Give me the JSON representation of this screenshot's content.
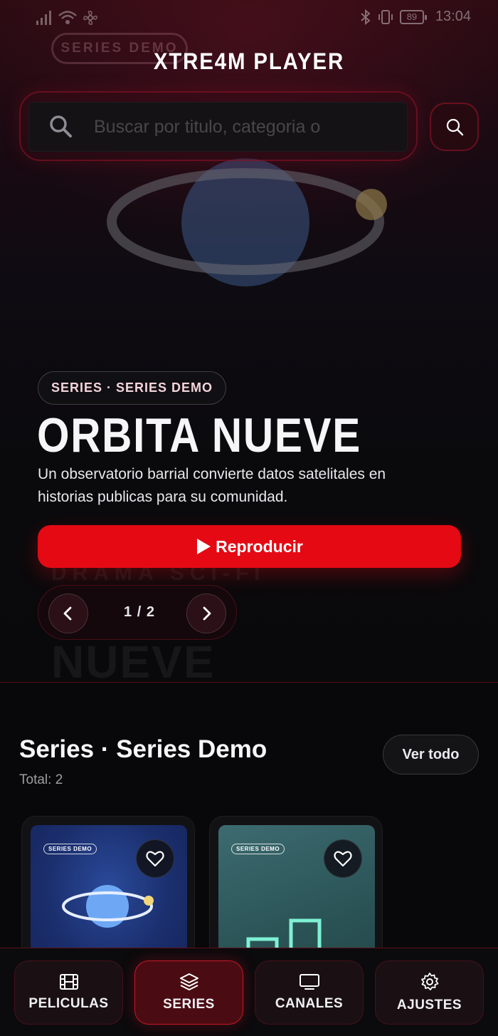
{
  "status_bar": {
    "time": "13:04",
    "battery": "89"
  },
  "app": {
    "title": "XTRE4M PLAYER"
  },
  "search": {
    "placeholder": "Buscar por titulo, categoria o"
  },
  "hero": {
    "background_badge": "SERIES DEMO",
    "background_genre": "DRAMA SCI-FI",
    "background_title": "NUEVE",
    "category_badge": "SERIES · SERIES DEMO",
    "title": "ORBITA NUEVE",
    "description": "Un observatorio barrial convierte datos satelitales en historias publicas para su comunidad.",
    "play_label": "Reproducir",
    "page_indicator": "1 / 2"
  },
  "section": {
    "title": "Series · Series Demo",
    "total": "Total: 2",
    "see_all_label": "Ver todo"
  },
  "cards": [
    {
      "tag": "SERIES DEMO",
      "icon": "heart-icon"
    },
    {
      "tag": "SERIES DEMO",
      "icon": "heart-icon"
    }
  ],
  "bottom_nav": [
    {
      "label": "PELICULAS",
      "icon": "film-icon",
      "active": false
    },
    {
      "label": "SERIES",
      "icon": "layers-icon",
      "active": true
    },
    {
      "label": "CANALES",
      "icon": "tv-icon",
      "active": false
    },
    {
      "label": "AJUSTES",
      "icon": "gear-icon",
      "active": false
    }
  ],
  "colors": {
    "accent": "#e50914",
    "background": "#08080a",
    "active_nav": "#4a0c12"
  }
}
